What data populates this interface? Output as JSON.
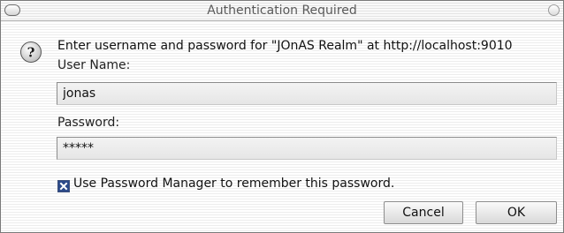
{
  "window": {
    "title": "Authentication Required"
  },
  "dialog": {
    "message": "Enter username and password for \"JOnAS Realm\" at http://localhost:9010",
    "username_label": "User Name:",
    "username_value": "jonas",
    "password_label": "Password:",
    "password_value": "*****",
    "remember_label": "Use Password Manager to remember this password.",
    "remember_checked": true
  },
  "buttons": {
    "cancel": "Cancel",
    "ok": "OK"
  },
  "icons": {
    "dialog": "question-icon",
    "close": "close-icon",
    "menu": "window-menu-icon"
  },
  "colors": {
    "accent": "#2c4a8a"
  }
}
